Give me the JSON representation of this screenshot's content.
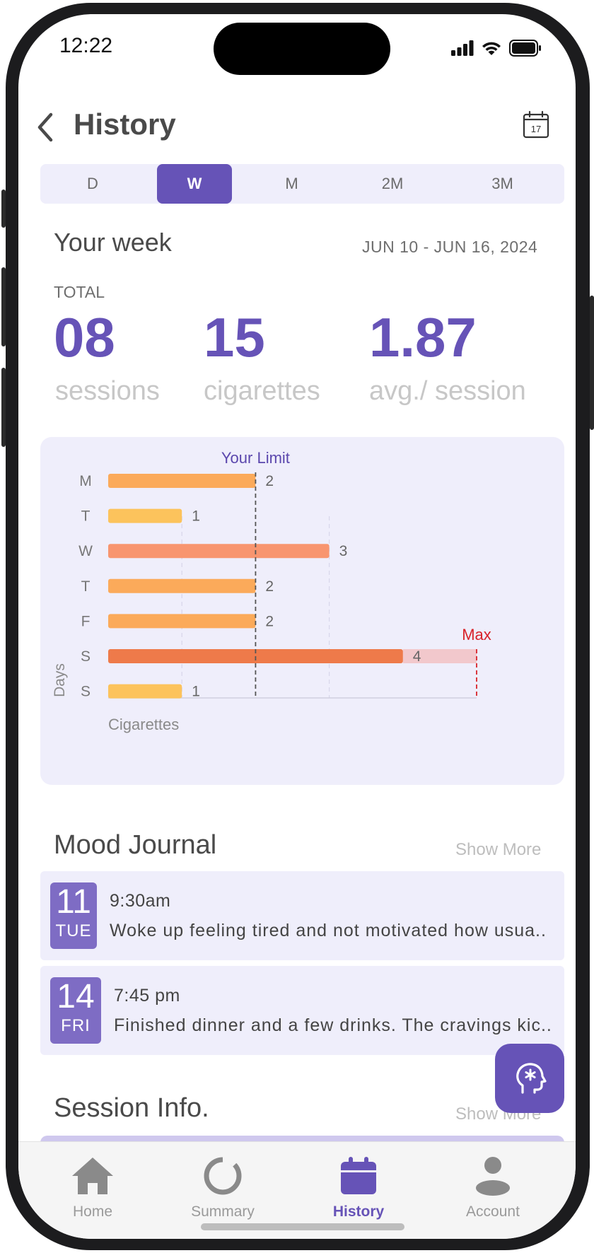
{
  "status_bar": {
    "time": "12:22"
  },
  "header": {
    "title": "History",
    "back_icon": "chevron-left-icon",
    "calendar_icon": "calendar-icon",
    "calendar_day": "17"
  },
  "range_tabs": [
    {
      "label": "D",
      "active": false
    },
    {
      "label": "W",
      "active": true
    },
    {
      "label": "M",
      "active": false
    },
    {
      "label": "2M",
      "active": false
    },
    {
      "label": "3M",
      "active": false
    }
  ],
  "summary": {
    "title": "Your week",
    "date_range": "JUN 10 - JUN 16, 2024",
    "total_label": "TOTAL",
    "stats": [
      {
        "value": "08",
        "label": "sessions"
      },
      {
        "value": "15",
        "label": "cigarettes"
      },
      {
        "value": "1.87",
        "label": "avg./ session"
      }
    ]
  },
  "chart_data": {
    "type": "bar",
    "orientation": "horizontal",
    "categories": [
      "M",
      "T",
      "W",
      "T",
      "F",
      "S",
      "S"
    ],
    "values": [
      2,
      1,
      3,
      2,
      2,
      4,
      1
    ],
    "xlabel": "Cigarettes",
    "ylabel": "Days",
    "xlim": [
      0,
      5
    ],
    "limit": {
      "value": 2,
      "label": "Your Limit"
    },
    "max": {
      "value": 5,
      "label": "Max",
      "applies_to_index": 5
    },
    "bar_colors": [
      "#fbaa5a",
      "#fcc35c",
      "#f8956f",
      "#fbaa5a",
      "#fbaa5a",
      "#ee7a4a",
      "#fcc35c"
    ],
    "colors": {
      "limit_line": "#555555",
      "max_line": "#d8232a",
      "max_label": "#d8232a",
      "limit_label": "#5b47ad",
      "overflow_fill": "#f2c8cc"
    }
  },
  "mood_journal": {
    "title": "Mood Journal",
    "show_more": "Show More",
    "entries": [
      {
        "day": "11",
        "weekday": "TUE",
        "time": "9:30am",
        "text": "Woke up feeling tired and not motivated how usua.."
      },
      {
        "day": "14",
        "weekday": "FRI",
        "time": "7:45 pm",
        "text": "Finished dinner and a few drinks. The cravings kic.."
      }
    ]
  },
  "session_info": {
    "title": "Session Info.",
    "show_more": "Show More"
  },
  "fab": {
    "icon": "mind-head-icon"
  },
  "tab_bar": [
    {
      "label": "Home",
      "icon": "home-icon",
      "active": false
    },
    {
      "label": "Summary",
      "icon": "ring-icon",
      "active": false
    },
    {
      "label": "History",
      "icon": "calendar-icon",
      "active": true
    },
    {
      "label": "Account",
      "icon": "person-icon",
      "active": false
    }
  ],
  "colors": {
    "accent": "#6653b7",
    "card_bg": "#efeefb"
  }
}
